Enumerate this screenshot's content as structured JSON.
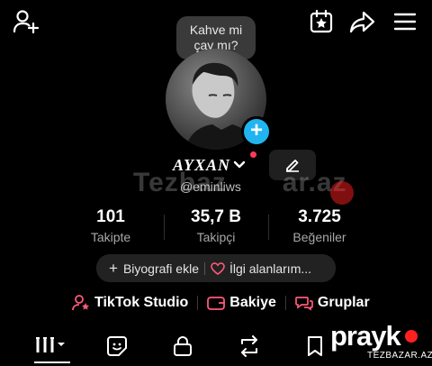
{
  "note": {
    "text_line1": "Kahve mi",
    "text_line2": "çay mı?"
  },
  "profile": {
    "name": "AYXAN",
    "handle": "@eminliws"
  },
  "stats": [
    {
      "value": "101",
      "label": "Takipte"
    },
    {
      "value": "35,7 B",
      "label": "Takipçi"
    },
    {
      "value": "3.725",
      "label": "Beğeniler"
    }
  ],
  "bio": {
    "add_label": "Biyografi ekle",
    "interests_label": "İlgi alanlarım..."
  },
  "links": {
    "studio": "TikTok Studio",
    "balance": "Bakiye",
    "groups": "Gruplar"
  },
  "watermark": {
    "center": "Tezbaz",
    "center_right": "ar.az",
    "brand": "prayk",
    "site": "TEZBAZAR.AZ"
  },
  "colors": {
    "accent_red": "#ff3b5c",
    "plus_blue": "#20b5f0",
    "background": "#000000"
  },
  "icons": {
    "top_bar": [
      "add-friend-icon",
      "calendar-star-icon",
      "share-icon",
      "menu-icon"
    ],
    "tabs": [
      "grid-icon",
      "sticker-icon",
      "lock-icon",
      "repost-icon",
      "bookmark-icon"
    ]
  }
}
